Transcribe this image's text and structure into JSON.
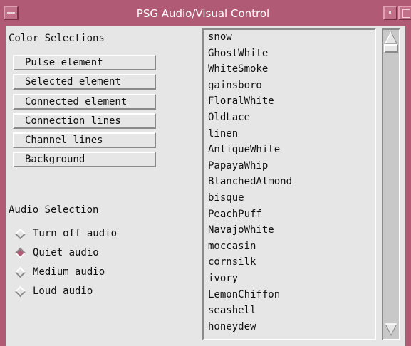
{
  "window": {
    "title": "PSG Audio/Visual Control"
  },
  "color_selections": {
    "heading": "Color Selections",
    "buttons": [
      "Pulse element",
      "Selected element",
      "Connected element",
      "Connection lines",
      "Channel lines",
      "Background"
    ]
  },
  "audio_selection": {
    "heading": "Audio Selection",
    "options": [
      {
        "label": "Turn off audio",
        "selected": false
      },
      {
        "label": "Quiet audio",
        "selected": true
      },
      {
        "label": "Medium audio",
        "selected": false
      },
      {
        "label": "Loud audio",
        "selected": false
      }
    ]
  },
  "color_list": {
    "items": [
      "snow",
      "GhostWhite",
      "WhiteSmoke",
      "gainsboro",
      "FloralWhite",
      "OldLace",
      "linen",
      "AntiqueWhite",
      "PapayaWhip",
      "BlanchedAlmond",
      "bisque",
      "PeachPuff",
      "NavajoWhite",
      "moccasin",
      "cornsilk",
      "ivory",
      "LemonChiffon",
      "seashell",
      "honeydew"
    ]
  },
  "colors": {
    "title_bar": "#b05a75",
    "panel_background": "#e6e6e6",
    "selected_radio": "#b05a75"
  }
}
